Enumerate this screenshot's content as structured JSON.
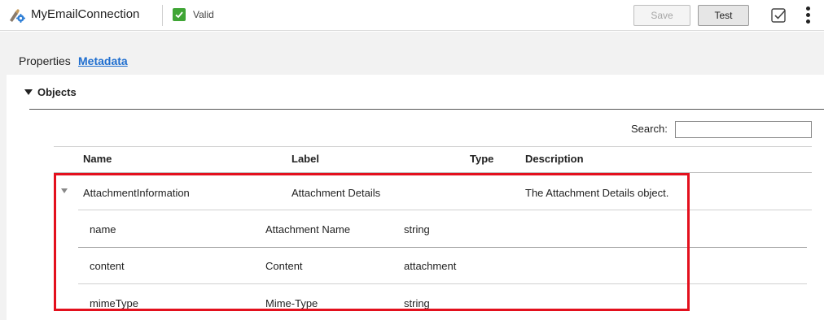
{
  "header": {
    "connection_name": "MyEmailConnection",
    "status": "Valid",
    "save_label": "Save",
    "test_label": "Test",
    "connection_icon": "connection-gear-icon",
    "check_icon": "checkbox-icon",
    "more_icon": "kebab-menu-icon"
  },
  "tabs": [
    {
      "label": "Properties",
      "active": false
    },
    {
      "label": "Metadata",
      "active": true
    }
  ],
  "objects": {
    "title": "Objects",
    "search_label": "Search:",
    "search_value": "",
    "columns": [
      "Name",
      "Label",
      "Type",
      "Description"
    ],
    "parent": {
      "name": "AttachmentInformation",
      "label": "Attachment Details",
      "type": "",
      "description": "The Attachment Details object."
    },
    "fields": [
      {
        "name": "name",
        "label": "Attachment Name",
        "type": "string"
      },
      {
        "name": "content",
        "label": "Content",
        "type": "attachment"
      },
      {
        "name": "mimeType",
        "label": "Mime-Type",
        "type": "string"
      }
    ]
  },
  "colors": {
    "accent": "#1f6ecf",
    "valid": "#3fa535",
    "highlight": "#e3101d"
  }
}
